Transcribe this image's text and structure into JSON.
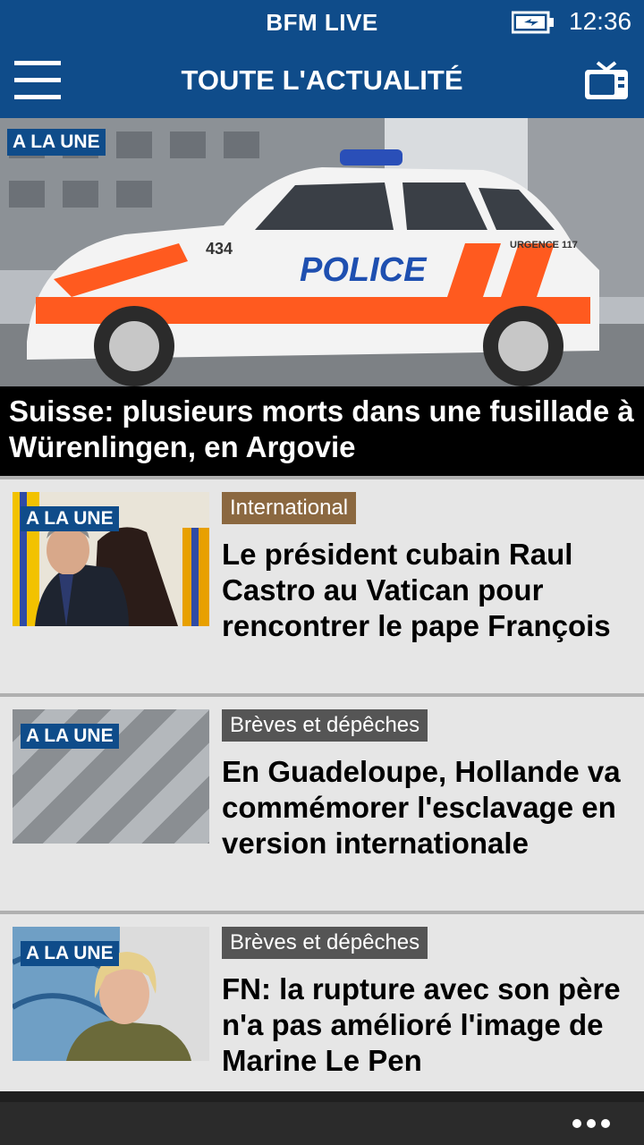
{
  "status": {
    "app_name": "BFM LIVE",
    "time": "12:36"
  },
  "header": {
    "title": "TOUTE L'ACTUALITÉ"
  },
  "hero": {
    "badge": "A LA UNE",
    "headline": "Suisse: plusieurs morts dans une fusillade à Würenlingen, en Argovie",
    "image_text": {
      "car_word": "POLICE",
      "car_number": "434",
      "car_side": "URGENCE 117"
    }
  },
  "articles": [
    {
      "badge": "A LA UNE",
      "category": "International",
      "category_color": "#8b6840",
      "headline": "Le président cubain Raul Castro au Vatican pour rencontrer le pape François"
    },
    {
      "badge": "A LA UNE",
      "category": "Brèves et dépêches",
      "category_color": "#555555",
      "headline": "En Guadeloupe, Hollande va commémorer l'esclavage en version internationale"
    },
    {
      "badge": "A LA UNE",
      "category": "Brèves et dépêches",
      "category_color": "#555555",
      "headline": "FN: la rupture avec son père n'a pas amélioré l'image de Marine Le Pen"
    }
  ],
  "colors": {
    "brand": "#0f4c8a",
    "caption_bg": "#000000",
    "page_bg": "#e6e6e6",
    "appbar": "#2b2b2b"
  },
  "icons": {
    "menu": "hamburger-icon",
    "tv": "tv-icon",
    "battery": "battery-charging-icon",
    "more": "more-dots-icon"
  }
}
